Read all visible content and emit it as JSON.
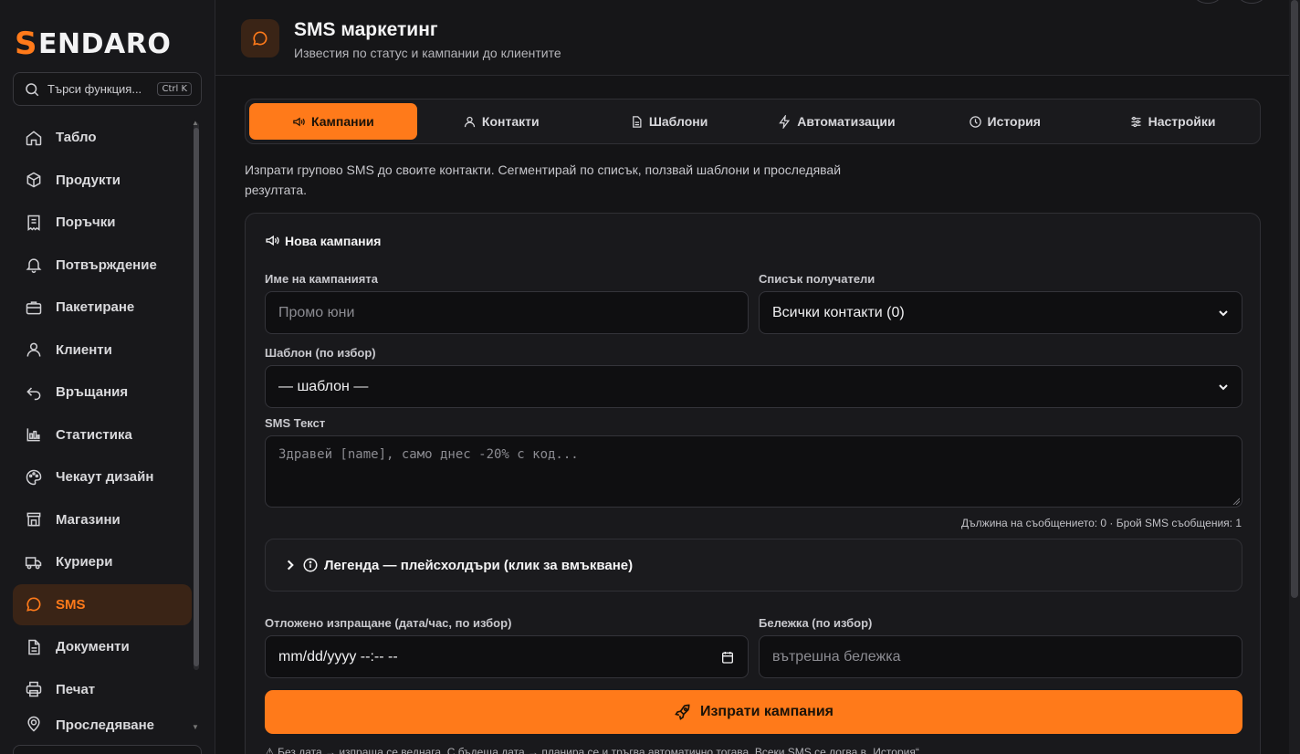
{
  "brand": {
    "logo_s": "S",
    "logo_rest": "ENDARO",
    "accent": "#ff7a1a"
  },
  "search": {
    "placeholder": "Търси функция...",
    "shortcut": "Ctrl K"
  },
  "sidebar": {
    "items": [
      {
        "label": "Табло",
        "icon": "home-icon"
      },
      {
        "label": "Продукти",
        "icon": "box-icon"
      },
      {
        "label": "Поръчки",
        "icon": "receipt-icon"
      },
      {
        "label": "Потвърждение",
        "icon": "bell-icon"
      },
      {
        "label": "Пакетиране",
        "icon": "briefcase-icon"
      },
      {
        "label": "Клиенти",
        "icon": "user-icon"
      },
      {
        "label": "Връщания",
        "icon": "return-icon"
      },
      {
        "label": "Статистика",
        "icon": "bar-chart-icon"
      },
      {
        "label": "Чекаут дизайн",
        "icon": "palette-icon"
      },
      {
        "label": "Магазини",
        "icon": "store-icon"
      },
      {
        "label": "Куриери",
        "icon": "truck-icon"
      },
      {
        "label": "SMS",
        "icon": "chat-icon",
        "active": true
      },
      {
        "label": "Документи",
        "icon": "document-icon"
      },
      {
        "label": "Печат",
        "icon": "printer-icon"
      },
      {
        "label": "Проследяване",
        "icon": "location-icon"
      }
    ]
  },
  "header": {
    "title": "SMS маркетинг",
    "subtitle": "Известия по статус и кампании до клиентите"
  },
  "tabs": [
    {
      "label": "Кампании",
      "icon": "megaphone-icon",
      "active": true
    },
    {
      "label": "Контакти",
      "icon": "user-icon"
    },
    {
      "label": "Шаблони",
      "icon": "file-icon"
    },
    {
      "label": "Автоматизации",
      "icon": "bolt-icon"
    },
    {
      "label": "История",
      "icon": "clock-icon"
    },
    {
      "label": "Настройки",
      "icon": "sliders-icon"
    }
  ],
  "intro": "Изпрати групово SMS до своите контакти. Сегментирай по списък, ползвай шаблони и проследявай резултата.",
  "form": {
    "title": "Нова кампания",
    "name_label": "Име на кампанията",
    "name_placeholder": "Промо юни",
    "list_label": "Списък получатели",
    "list_value": "Всички контакти (0)",
    "template_label": "Шаблон (по избор)",
    "template_value": "— шаблон —",
    "sms_label": "SMS Текст",
    "sms_placeholder": "Здравей [name], само днес -20% с код...",
    "counter": "Дължина на съобщението: 0 · Брой SMS съобщения: 1",
    "legend": "Легенда — плейсхолдъри (клик за вмъкване)",
    "schedule_label": "Отложено изпращане (дата/час, по избор)",
    "schedule_value": "mm/dd/yyyy --:-- --",
    "note_label": "Бележка (по избор)",
    "note_placeholder": "вътрешна бележка",
    "send_button": "Изпрати кампания",
    "footnote": "Без дата → изпраща се веднага. С бъдеща дата → планира се и тръгва автоматично тогава. Всеки SMS се логва в „История“."
  }
}
